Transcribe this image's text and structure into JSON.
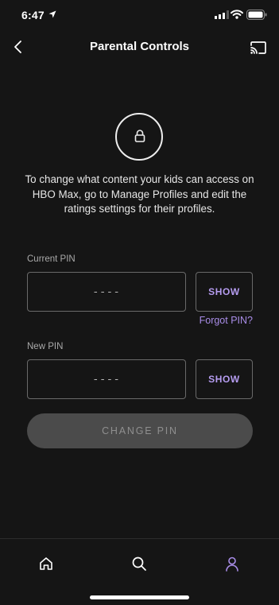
{
  "status_bar": {
    "time": "6:47"
  },
  "header": {
    "title": "Parental Controls"
  },
  "description": "To change what content your kids can access on HBO Max, go to Manage Profiles and edit the ratings settings for their profiles.",
  "current_pin": {
    "label": "Current PIN",
    "placeholder": "----",
    "show_label": "SHOW",
    "forgot_label": "Forgot PIN?"
  },
  "new_pin": {
    "label": "New PIN",
    "placeholder": "----",
    "show_label": "SHOW"
  },
  "change_pin_label": "CHANGE PIN",
  "tab_bar": {
    "items": [
      {
        "icon": "home-icon",
        "active": false
      },
      {
        "icon": "search-icon",
        "active": false
      },
      {
        "icon": "profile-icon",
        "active": true
      }
    ]
  },
  "colors": {
    "background": "#151515",
    "accent": "#a98de8",
    "button_disabled": "#4b4b4b"
  }
}
